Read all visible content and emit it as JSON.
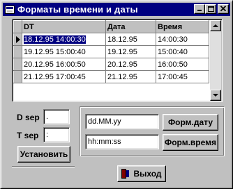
{
  "window": {
    "title": "Форматы времени и даты"
  },
  "grid": {
    "columns": [
      "DT",
      "Дата",
      "Время"
    ],
    "rows": [
      [
        "18.12.95 14:00:30",
        "18.12.95",
        "14:00:30"
      ],
      [
        "19.12.95 15:00:40",
        "19.12.95",
        "15:00:40"
      ],
      [
        "20.12.95 16:00:50",
        "20.12.95",
        "16:00:50"
      ],
      [
        "21.12.95 17:00:45",
        "21.12.95",
        "17:00:45"
      ]
    ],
    "selected_row": 0
  },
  "separators": {
    "d_label": "D sep",
    "d_value": ".",
    "t_label": "T sep",
    "t_value": ":",
    "set_button": "Установить"
  },
  "formats": {
    "date_format": "dd.MM.yy",
    "time_format": "hh:mm:ss",
    "date_button": "Форм.дату",
    "time_button": "Форм.время"
  },
  "footer": {
    "exit_button": "Выход"
  }
}
